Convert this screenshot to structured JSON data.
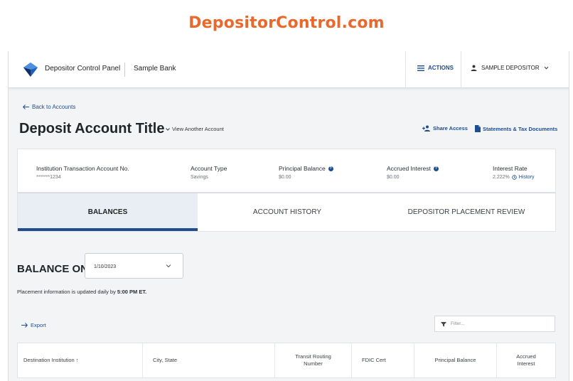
{
  "site": {
    "title": "DepositorControl.com"
  },
  "header": {
    "app_name": "Depositor Control Panel",
    "bank_name": "Sample Bank",
    "actions_label": "ACTIONS",
    "user_label": "SAMPLE DEPOSITOR"
  },
  "nav": {
    "back_label": "Back to Accounts"
  },
  "page": {
    "title": "Deposit Account Title",
    "view_another_label": "View Another Account",
    "share_label": "Share Access",
    "statements_label": "Statements & Tax Documents"
  },
  "account": {
    "txn_label": "Institution Transaction Account No.",
    "txn_value": "*******1234",
    "type_label": "Account Type",
    "type_value": "Savings",
    "principal_label": "Principal Balance",
    "principal_value": "$0.00",
    "accrued_label": "Accrued Interest",
    "accrued_value": "$0.00",
    "rate_label": "Interest Rate",
    "rate_value": "2.222%",
    "history_label": "History"
  },
  "tabs": [
    {
      "label": "BALANCES",
      "active": true
    },
    {
      "label": "ACCOUNT HISTORY",
      "active": false
    },
    {
      "label": "DEPOSITOR PLACEMENT REVIEW",
      "active": false
    }
  ],
  "balance": {
    "label": "BALANCE ON",
    "date": "1/10/2023",
    "info_prefix": "Placement information is updated daily by",
    "info_time": "5:00 PM ET."
  },
  "table": {
    "export_label": "Export",
    "filter_placeholder": "Filter...",
    "columns": [
      "Destination Institution ↑",
      "City, State",
      "Transit Routing Number",
      "FDIC Cert",
      "Principal Balance",
      "Accrued Interest"
    ]
  },
  "colors": {
    "brand_orange": "#e8692b",
    "accent_blue": "#1d4c8f"
  }
}
